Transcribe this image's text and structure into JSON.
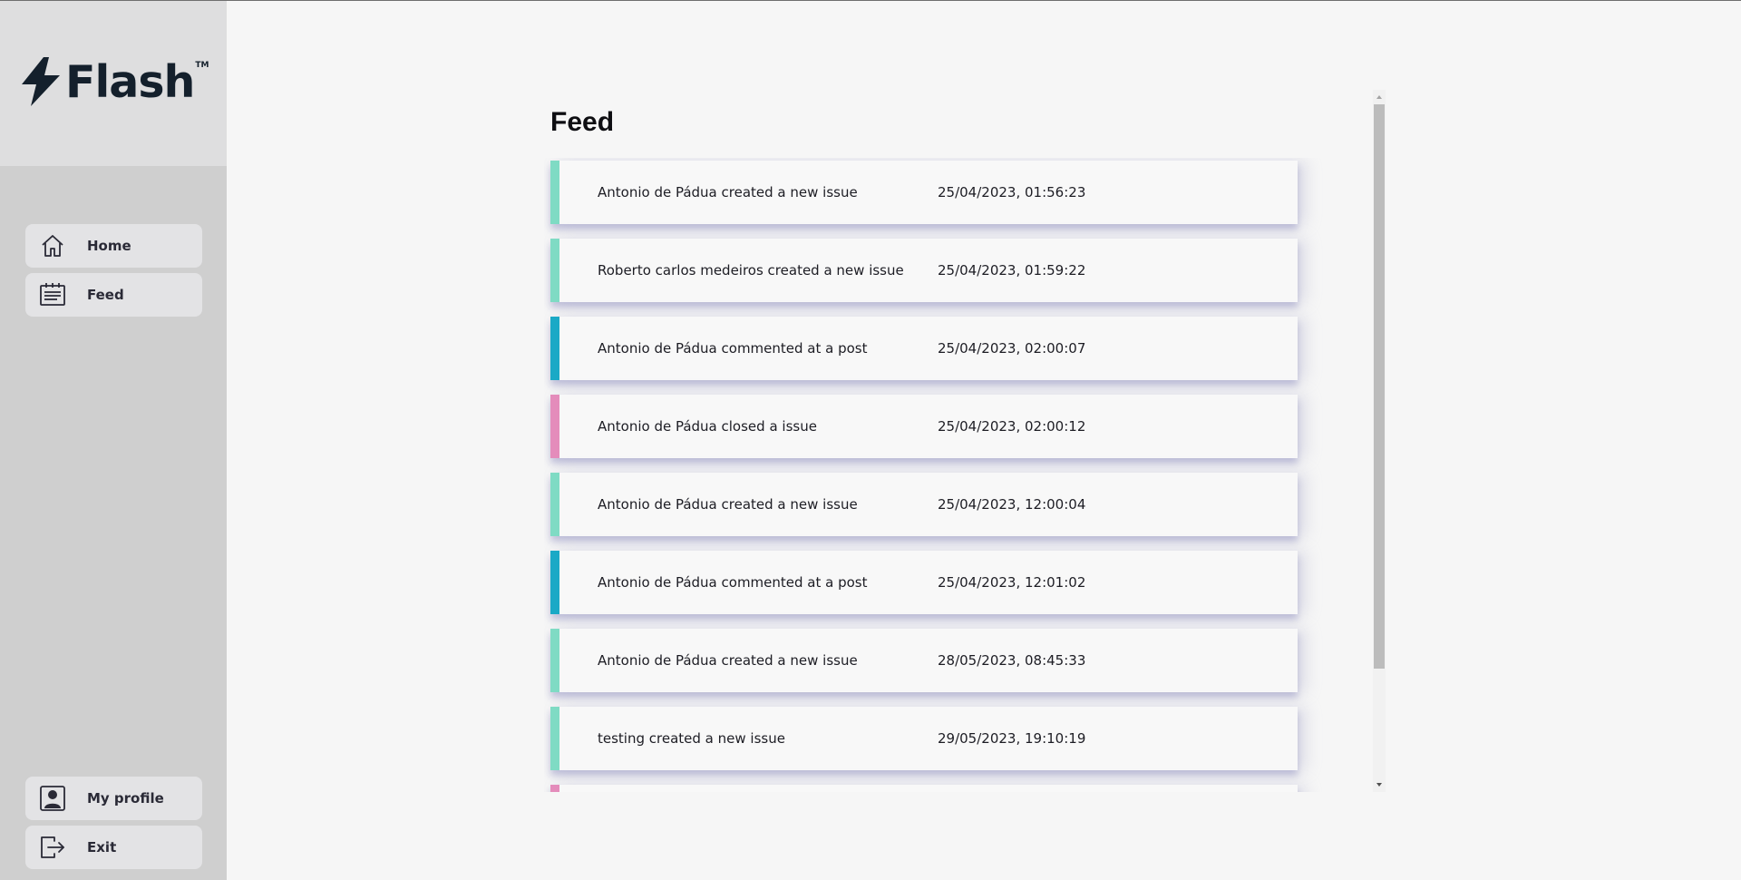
{
  "app": {
    "name": "Flash",
    "trademark": "TM"
  },
  "sidebar": {
    "top_items": [
      {
        "label": "Home",
        "icon": "home-icon"
      },
      {
        "label": "Feed",
        "icon": "feed-icon"
      }
    ],
    "bottom_items": [
      {
        "label": "My profile",
        "icon": "profile-icon"
      },
      {
        "label": "Exit",
        "icon": "exit-icon"
      }
    ]
  },
  "main": {
    "title": "Feed",
    "feed": [
      {
        "text": "Antonio de Pádua created a new issue",
        "date": "25/04/2023, 01:56:23",
        "type": "created",
        "color": "#7fdbc4"
      },
      {
        "text": "Roberto carlos medeiros created a new issue",
        "date": "25/04/2023, 01:59:22",
        "type": "created",
        "color": "#7fdbc4"
      },
      {
        "text": "Antonio de Pádua commented at a post",
        "date": "25/04/2023, 02:00:07",
        "type": "commented",
        "color": "#1aa9c6"
      },
      {
        "text": "Antonio de Pádua closed a issue",
        "date": "25/04/2023, 02:00:12",
        "type": "closed",
        "color": "#e48cbb"
      },
      {
        "text": "Antonio de Pádua created a new issue",
        "date": "25/04/2023, 12:00:04",
        "type": "created",
        "color": "#7fdbc4"
      },
      {
        "text": "Antonio de Pádua commented at a post",
        "date": "25/04/2023, 12:01:02",
        "type": "commented",
        "color": "#1aa9c6"
      },
      {
        "text": "Antonio de Pádua created a new issue",
        "date": "28/05/2023, 08:45:33",
        "type": "created",
        "color": "#7fdbc4"
      },
      {
        "text": "testing created a new issue",
        "date": "29/05/2023, 19:10:19",
        "type": "created",
        "color": "#7fdbc4"
      },
      {
        "text": "",
        "date": "",
        "type": "closed",
        "color": "#e48cbb"
      }
    ]
  },
  "colors": {
    "created": "#7fdbc4",
    "commented": "#1aa9c6",
    "closed": "#e48cbb"
  }
}
